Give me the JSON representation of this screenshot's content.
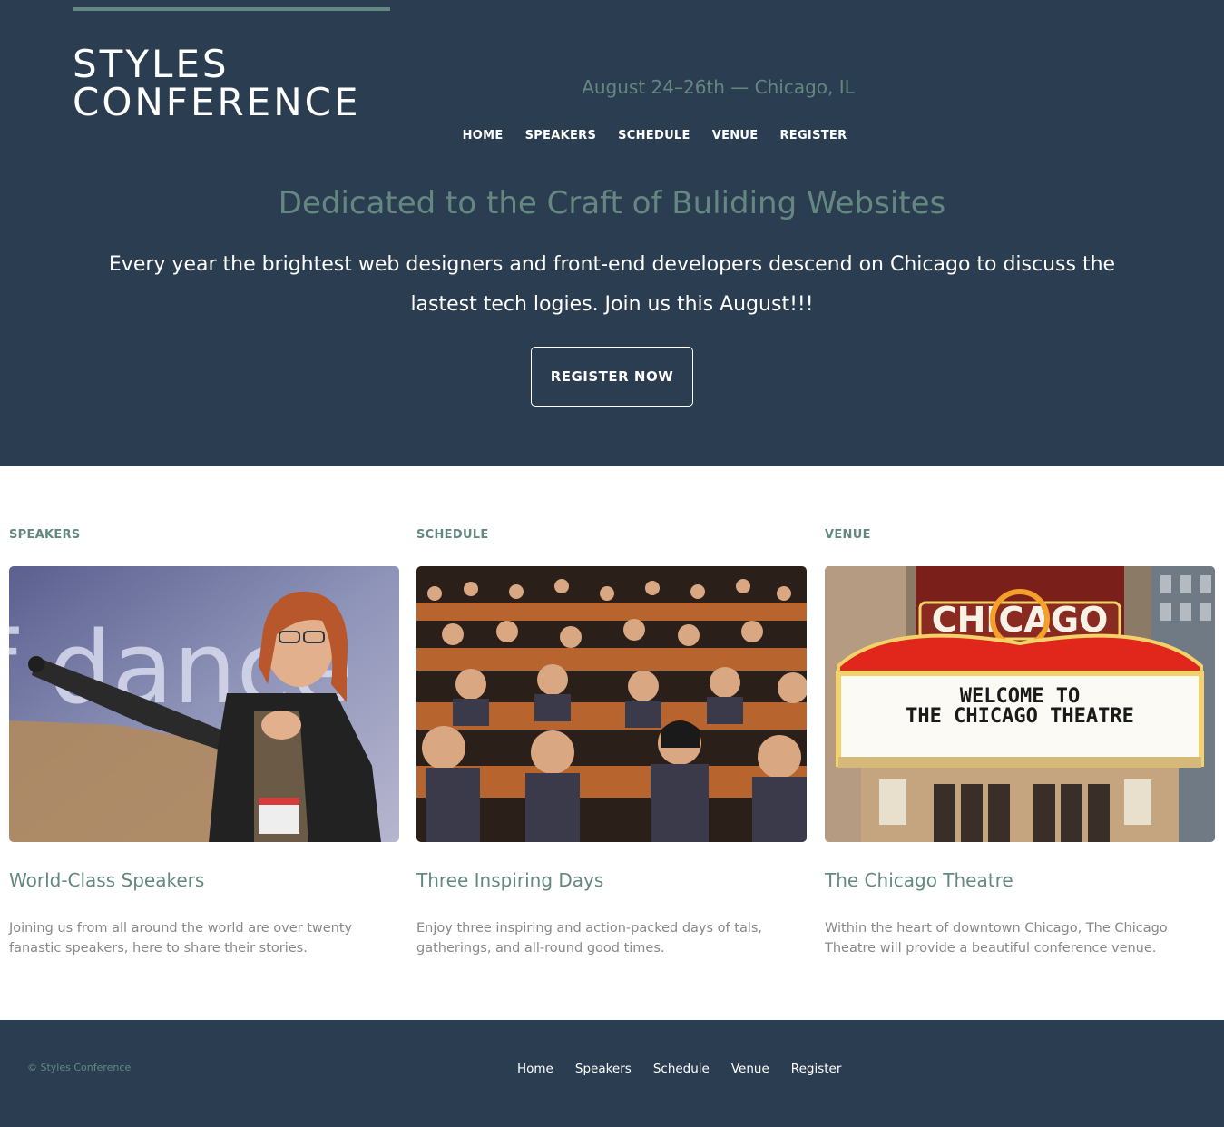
{
  "header": {
    "logo_line1": "STYLES",
    "logo_line2": "CONFERENCE",
    "tagline": "August 24–26th — Chicago, IL",
    "nav": [
      "HOME",
      "SPEAKERS",
      "SCHEDULE",
      "VENUE",
      "REGISTER"
    ]
  },
  "hero": {
    "title": "Dedicated to the Craft of Buliding Websites",
    "text": "Every year the brightest web designers and front-end developers descend on Chicago to discuss the lastest tech logies. Join us this August!!!",
    "cta_label": "REGISTER NOW"
  },
  "features": [
    {
      "heading": "SPEAKERS",
      "image": "speaker-photo",
      "title": "World-Class Speakers",
      "text": "Joining us from all around the world are over twenty fanastic speakers, here to share their stories."
    },
    {
      "heading": "SCHEDULE",
      "image": "audience-photo",
      "title": "Three Inspiring Days",
      "text": "Enjoy three inspiring and action-packed days of tals, gatherings, and all-round good times."
    },
    {
      "heading": "VENUE",
      "image": "theatre-photo",
      "title": "The Chicago Theatre",
      "text": "Within the heart of downtown Chicago, The Chicago Theatre will provide a beautiful conference venue.",
      "image_sign_main": "CHICAGO",
      "image_marquee_line1": "WELCOME TO",
      "image_marquee_line2": "THE CHICAGO THEATRE"
    }
  ],
  "speaker_image_text": "f dance",
  "footer": {
    "copyright": "© Styles Conference",
    "nav": [
      "Home",
      "Speakers",
      "Schedule",
      "Venue",
      "Register"
    ]
  },
  "colors": {
    "primary_dark": "#2b3d51",
    "accent_green": "#648880",
    "body_text_gray": "#888888",
    "white": "#ffffff"
  }
}
